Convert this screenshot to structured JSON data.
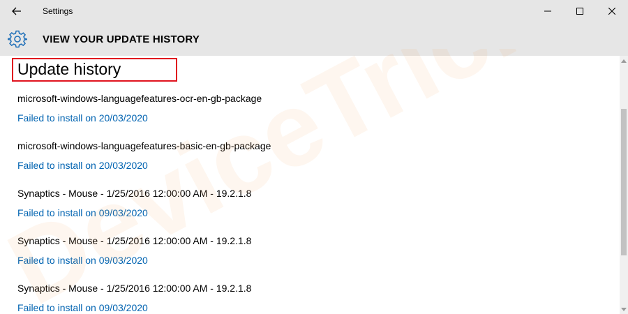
{
  "window": {
    "app_title": "Settings"
  },
  "header": {
    "title": "VIEW YOUR UPDATE HISTORY"
  },
  "content": {
    "section_heading": "Update history",
    "updates": [
      {
        "name": "microsoft-windows-languagefeatures-ocr-en-gb-package",
        "status": "Failed to install on 20/03/2020"
      },
      {
        "name": "microsoft-windows-languagefeatures-basic-en-gb-package",
        "status": "Failed to install on 20/03/2020"
      },
      {
        "name": "Synaptics - Mouse - 1/25/2016 12:00:00 AM - 19.2.1.8",
        "status": "Failed to install on 09/03/2020"
      },
      {
        "name": "Synaptics - Mouse - 1/25/2016 12:00:00 AM - 19.2.1.8",
        "status": "Failed to install on 09/03/2020"
      },
      {
        "name": "Synaptics - Mouse - 1/25/2016 12:00:00 AM - 19.2.1.8",
        "status": "Failed to install on 09/03/2020"
      }
    ]
  },
  "watermark": {
    "text": "DeviceTricks"
  },
  "icons": {
    "back": "back-arrow-icon",
    "minimize": "minimize-icon",
    "maximize": "maximize-icon",
    "close": "close-icon",
    "settings": "gear-icon"
  },
  "colors": {
    "titlebar_bg": "#e6e6e6",
    "link": "#0063b1",
    "highlight_box": "#e0131f",
    "accent_icon": "#1f6fb8"
  }
}
